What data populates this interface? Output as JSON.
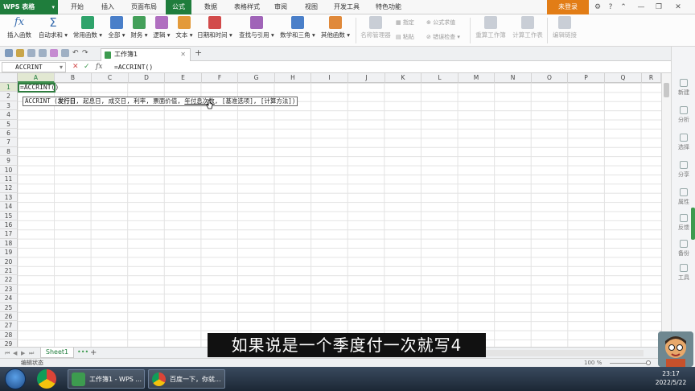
{
  "app": {
    "name": "WPS 表格",
    "login_label": "未登录",
    "menu_tabs": [
      "开始",
      "插入",
      "页面布局",
      "公式",
      "数据",
      "表格样式",
      "审阅",
      "视图",
      "开发工具",
      "特色功能"
    ],
    "active_tab": "公式",
    "accent_color": "#1f7d3c",
    "login_color": "#e27d16"
  },
  "ribbon": {
    "buttons": [
      {
        "label": "插入函数",
        "icon": "fx-icon"
      },
      {
        "label": "自动求和",
        "icon": "sigma-icon",
        "dropdown": true
      },
      {
        "label": "常用函数",
        "icon": "star-book-icon",
        "dropdown": true
      },
      {
        "label": "全部",
        "icon": "book-icon",
        "dropdown": true
      },
      {
        "label": "财务",
        "icon": "finance-book-icon",
        "dropdown": true
      },
      {
        "label": "逻辑",
        "icon": "question-book-icon",
        "dropdown": true
      },
      {
        "label": "文本",
        "icon": "text-book-icon",
        "dropdown": true
      },
      {
        "label": "日期和时间",
        "icon": "calendar-book-icon",
        "dropdown": true
      },
      {
        "label": "查找与引用",
        "icon": "search-book-icon",
        "dropdown": true
      },
      {
        "label": "数学和三角",
        "icon": "math-book-icon",
        "dropdown": true
      },
      {
        "label": "其他函数",
        "icon": "other-book-icon",
        "dropdown": true
      },
      {
        "label": "名称管理器",
        "icon": "name-manager-icon"
      },
      {
        "label": "重算工作簿",
        "icon": "recalc-workbook-icon"
      },
      {
        "label": "计算工作表",
        "icon": "calc-sheet-icon"
      },
      {
        "label": "编辑链接",
        "icon": "edit-link-icon"
      }
    ],
    "small_buttons": {
      "define": "指定",
      "paste": "粘贴",
      "formula_values": "公式求值",
      "error_check": "错误检查"
    }
  },
  "tabbar": {
    "doc_tab": "工作簿1"
  },
  "formula_bar": {
    "name_box": "ACCRINT",
    "formula": "=ACCRINT()"
  },
  "grid": {
    "columns": [
      "A",
      "B",
      "C",
      "D",
      "E",
      "F",
      "G",
      "H",
      "I",
      "J",
      "K",
      "L",
      "M",
      "N",
      "O",
      "P",
      "Q",
      "R"
    ],
    "rows": [
      "1",
      "2",
      "3",
      "4",
      "5",
      "6",
      "7",
      "8",
      "9",
      "10",
      "11",
      "12",
      "13",
      "14",
      "15",
      "16",
      "17",
      "18",
      "19",
      "20",
      "21",
      "22",
      "23",
      "24",
      "25",
      "26",
      "27",
      "28",
      "29"
    ],
    "active_cell_value": "=ACCRINT()",
    "tooltip": {
      "func": "ACCRINT",
      "open": "(",
      "arg1": "发行日",
      "rest_before": ", 起息日, 成交日, 利率, 票面价值, ",
      "arg_highlight": "年付息次数",
      "rest_after": ", [基准选项], [计算方法])"
    }
  },
  "side_panel": [
    "新建",
    "分析",
    "选择",
    "分享",
    "属性",
    "反馈",
    "备份",
    "工具"
  ],
  "sheets": {
    "tabs": [
      "Sheet1"
    ],
    "more": "•••",
    "add": "+"
  },
  "status": {
    "mode": "编辑状态",
    "zoom": "100 %"
  },
  "subtitle": "如果说是一个季度付一次就写4",
  "taskbar": {
    "tasks": [
      "工作簿1 - WPS ...",
      "百度一下，你就..."
    ],
    "time": "23:17",
    "date": "2022/5/22"
  }
}
